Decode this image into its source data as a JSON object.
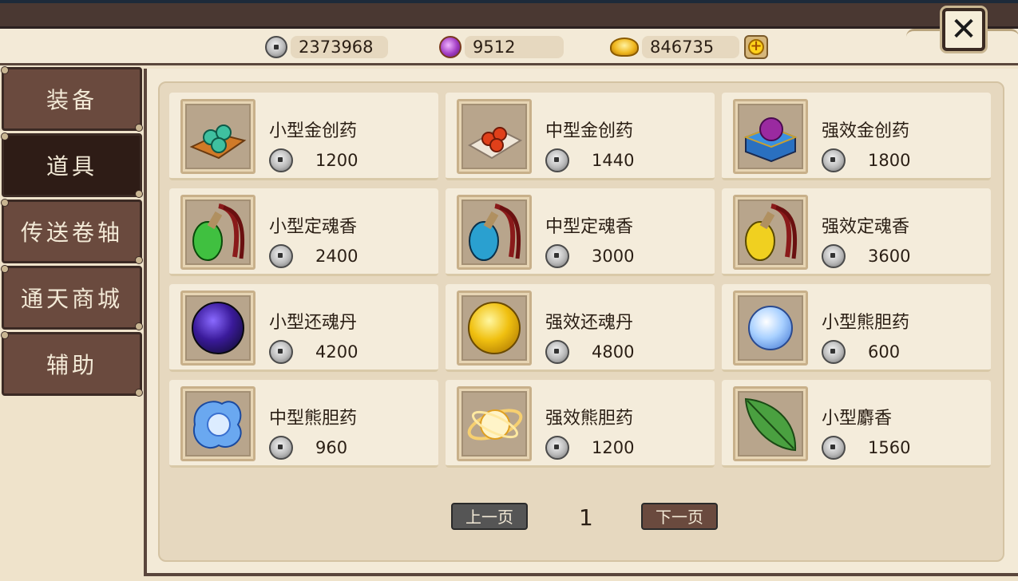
{
  "currencies": {
    "silver": "2373968",
    "gem": "9512",
    "gold": "846735"
  },
  "sidebar": {
    "tabs": [
      {
        "label": "装备"
      },
      {
        "label": "道具",
        "active": true
      },
      {
        "label": "传送卷轴"
      },
      {
        "label": "通天商城"
      },
      {
        "label": "辅助"
      }
    ]
  },
  "items": [
    {
      "name": "小型金创药",
      "price": "1200",
      "icon": "green-pills-on-cloth-icon"
    },
    {
      "name": "中型金创药",
      "price": "1440",
      "icon": "red-pills-on-cloth-icon"
    },
    {
      "name": "强效金创药",
      "price": "1800",
      "icon": "purple-gem-box-icon"
    },
    {
      "name": "小型定魂香",
      "price": "2400",
      "icon": "green-incense-pouch-icon"
    },
    {
      "name": "中型定魂香",
      "price": "3000",
      "icon": "blue-incense-pouch-icon"
    },
    {
      "name": "强效定魂香",
      "price": "3600",
      "icon": "yellow-incense-pouch-icon"
    },
    {
      "name": "小型还魂丹",
      "price": "4200",
      "icon": "dark-purple-orb-icon"
    },
    {
      "name": "强效还魂丹",
      "price": "4800",
      "icon": "golden-orb-icon"
    },
    {
      "name": "小型熊胆药",
      "price": "600",
      "icon": "light-blue-orb-icon"
    },
    {
      "name": "中型熊胆药",
      "price": "960",
      "icon": "blue-water-orb-icon"
    },
    {
      "name": "强效熊胆药",
      "price": "1200",
      "icon": "golden-swirl-orb-icon"
    },
    {
      "name": "小型麝香",
      "price": "1560",
      "icon": "green-leaf-icon"
    }
  ],
  "pager": {
    "prev_label": "上一页",
    "page": "1",
    "next_label": "下一页"
  }
}
